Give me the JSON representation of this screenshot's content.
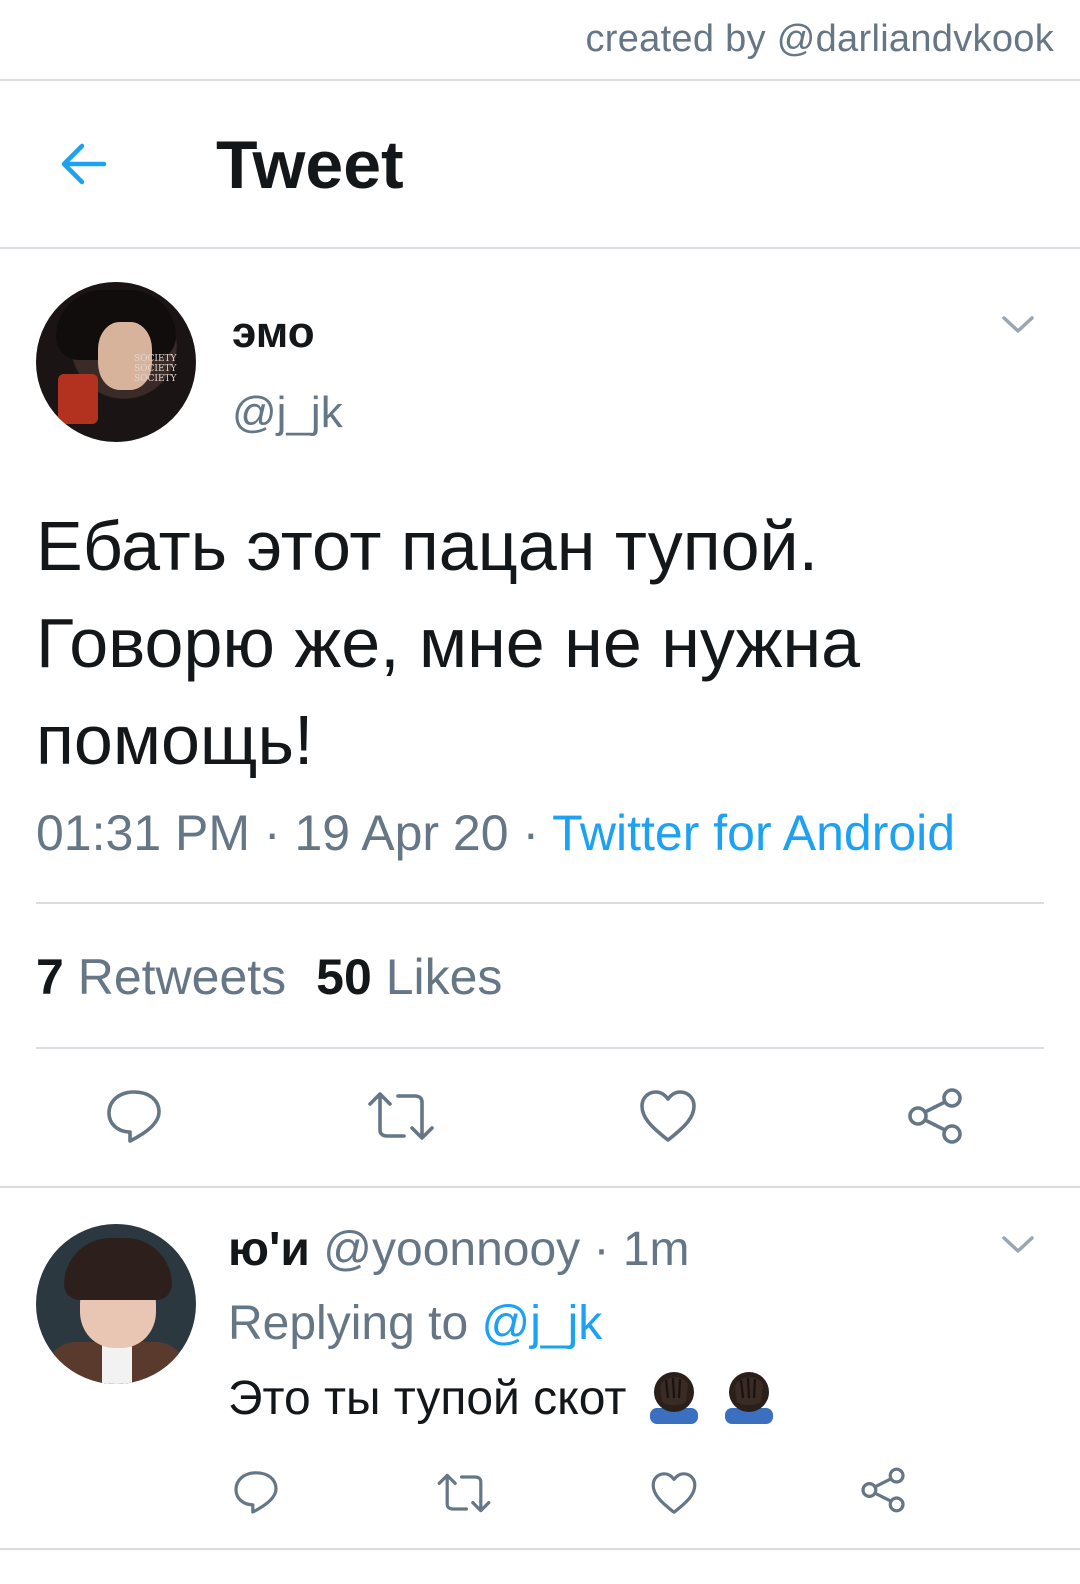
{
  "watermark": "created by @darliandvkook",
  "header": {
    "title": "Tweet",
    "back_icon": "arrow-left-icon"
  },
  "tweet": {
    "display_name": "эмо",
    "handle": "@j_jk",
    "avatar_text": [
      "SOCIETY",
      "SOCIETY",
      "SOCIETY"
    ],
    "text": "Ебать этот пацан тупой. Говорю же, мне не нужна помощь!",
    "time": "01:31 PM",
    "date": "19 Apr 20",
    "source": "Twitter for Android",
    "separator": "·",
    "retweets_count": "7",
    "retweets_label": "Retweets",
    "likes_count": "50",
    "likes_label": "Likes",
    "actions": [
      "reply-icon",
      "retweet-icon",
      "like-icon",
      "share-icon"
    ]
  },
  "reply": {
    "display_name": "ю'и",
    "handle": "@yoonnooy",
    "time": "1m",
    "separator": "·",
    "replying_to_label": "Replying to",
    "replying_to_handle": "@j_jk",
    "text": "Это ты тупой скот",
    "emoji": [
      "face-palm-emoji",
      "face-palm-emoji"
    ],
    "actions": [
      "reply-icon",
      "retweet-icon",
      "like-icon",
      "share-icon"
    ]
  },
  "colors": {
    "accent": "#1da1f2",
    "secondary_text": "#657786",
    "primary_text": "#14171a",
    "divider": "#d9dde1"
  }
}
